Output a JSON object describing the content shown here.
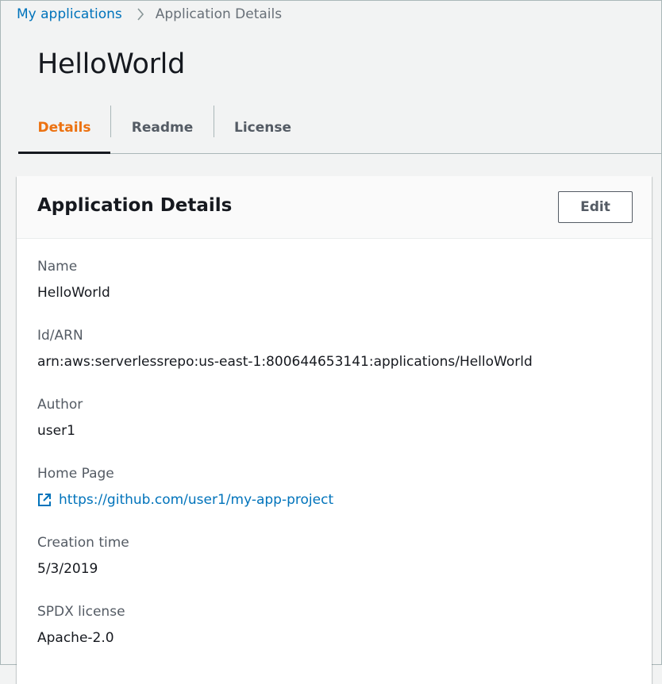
{
  "breadcrumb": {
    "parent": "My applications",
    "current": "Application Details"
  },
  "page": {
    "title": "HelloWorld"
  },
  "tabs": [
    {
      "label": "Details",
      "active": true
    },
    {
      "label": "Readme",
      "active": false
    },
    {
      "label": "License",
      "active": false
    }
  ],
  "card": {
    "title": "Application Details",
    "edit_label": "Edit",
    "fields": {
      "name": {
        "label": "Name",
        "value": "HelloWorld"
      },
      "arn": {
        "label": "Id/ARN",
        "value": "arn:aws:serverlessrepo:us-east-1:800644653141:applications/HelloWorld"
      },
      "author": {
        "label": "Author",
        "value": "user1"
      },
      "homepage": {
        "label": "Home Page",
        "value": "https://github.com/user1/my-app-project",
        "icon": "external-link-icon"
      },
      "created": {
        "label": "Creation time",
        "value": "5/3/2019"
      },
      "license": {
        "label": "SPDX license",
        "value": "Apache-2.0"
      }
    }
  },
  "colors": {
    "link": "#0073bb",
    "active_tab": "#ec7211",
    "text": "#16191f",
    "muted": "#545b64"
  }
}
